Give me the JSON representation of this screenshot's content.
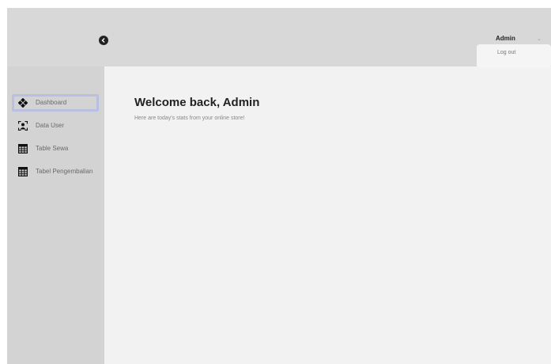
{
  "header": {
    "user_name": "Admin",
    "caret": "⌄",
    "dropdown": {
      "logout_label": "Log out"
    }
  },
  "sidebar": {
    "items": [
      {
        "label": "Dashboard",
        "icon": "diamond-grid-icon",
        "active": true
      },
      {
        "label": "Data User",
        "icon": "user-frame-icon",
        "active": false
      },
      {
        "label": "Table Sewa",
        "icon": "table-icon",
        "active": false
      },
      {
        "label": "Tabel Pengembalian",
        "icon": "table-icon",
        "active": false
      }
    ]
  },
  "main": {
    "title": "Welcome back, Admin",
    "subtitle": "Here are today's stats from your online store!"
  },
  "colors": {
    "topbar": "#d8d8d8",
    "sidebar": "#d3d3d3",
    "content": "#f2f2f2",
    "active_outline": "#b9bfe0"
  }
}
